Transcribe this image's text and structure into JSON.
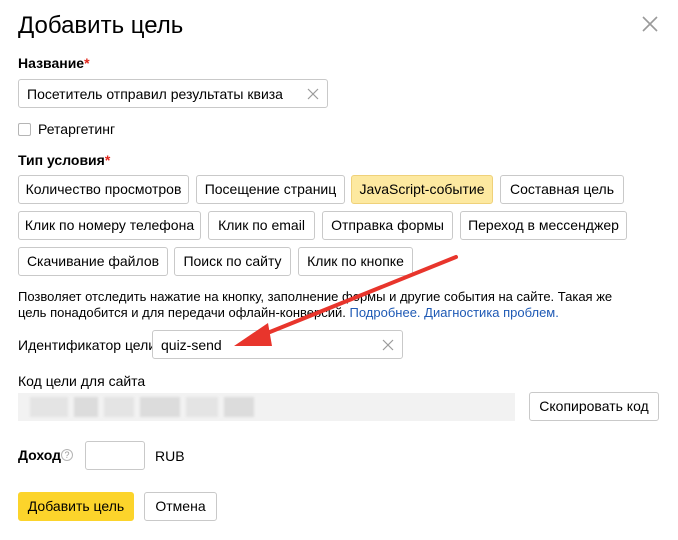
{
  "dialog": {
    "title": "Добавить цель"
  },
  "name_field": {
    "label": "Название",
    "required_mark": "*",
    "value": "Посетитель отправил результаты квиза"
  },
  "retargeting": {
    "label": "Ретаргетинг",
    "checked": false
  },
  "condition": {
    "label": "Тип условия",
    "required_mark": "*",
    "options": [
      "Количество просмотров",
      "Посещение страниц",
      "JavaScript-событие",
      "Составная цель",
      "Клик по номеру телефона",
      "Клик по email",
      "Отправка формы",
      "Переход в мессенджер",
      "Скачивание файлов",
      "Поиск по сайту",
      "Клик по кнопке"
    ],
    "selected": "JavaScript-событие"
  },
  "description": {
    "text": "Позволяет отследить нажатие на кнопку, заполнение формы и другие события на сайте. Такая же цель понадобится и для передачи офлайн-конверсий.",
    "link_more": "Подробнее.",
    "link_diagnostics": "Диагностика проблем."
  },
  "goal_id": {
    "label": "Идентификатор цели:",
    "value": "quiz-send"
  },
  "site_code": {
    "label": "Код цели для сайта",
    "copy_button": "Скопировать код"
  },
  "income": {
    "label": "Доход",
    "help_glyph": "?",
    "value": "",
    "currency": "RUB"
  },
  "footer": {
    "add_button": "Добавить цель",
    "cancel_button": "Отмена"
  },
  "colors": {
    "accent": "#fcd42b",
    "selected_chip": "#fde9a0",
    "required": "#e0261b",
    "link": "#1f5ab5",
    "annotation_arrow": "#e8352c"
  }
}
